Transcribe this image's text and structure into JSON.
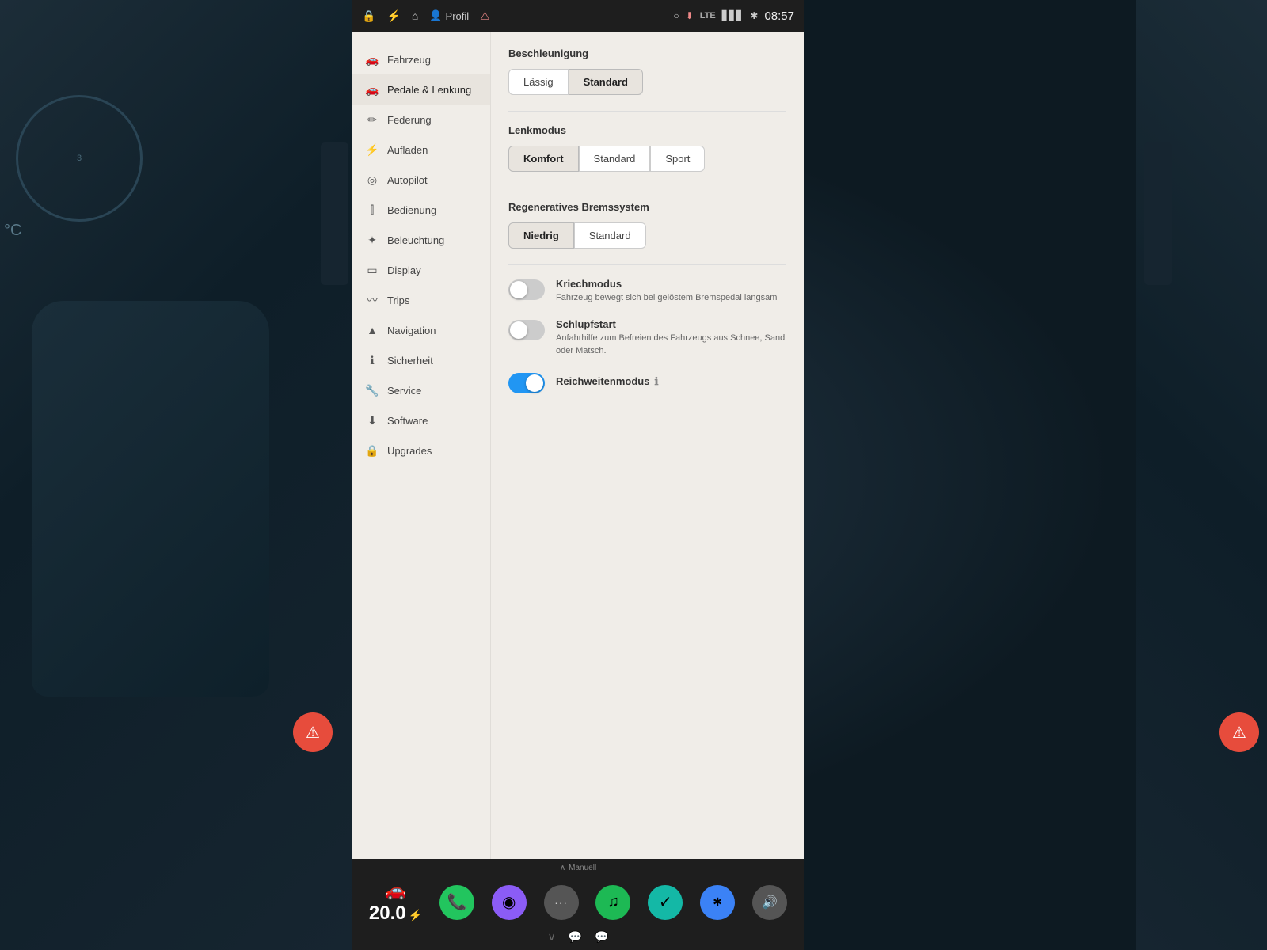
{
  "statusBar": {
    "icons": [
      "lock",
      "bolt",
      "home",
      "person",
      "warning"
    ],
    "profileLabel": "Profil",
    "time": "08:57",
    "lte": "LTE",
    "signalBars": "▋▋▋"
  },
  "sidebar": {
    "items": [
      {
        "id": "fahrzeug",
        "label": "Fahrzeug",
        "icon": "🚗",
        "active": false
      },
      {
        "id": "pedale-lenkung",
        "label": "Pedale & Lenkung",
        "icon": "🚗",
        "active": true
      },
      {
        "id": "federung",
        "label": "Federung",
        "icon": "✏",
        "active": false
      },
      {
        "id": "aufladen",
        "label": "Aufladen",
        "icon": "⚡",
        "active": false
      },
      {
        "id": "autopilot",
        "label": "Autopilot",
        "icon": "◎",
        "active": false
      },
      {
        "id": "bedienung",
        "label": "Bedienung",
        "icon": "≡",
        "active": false
      },
      {
        "id": "beleuchtung",
        "label": "Beleuchtung",
        "icon": "✦",
        "active": false
      },
      {
        "id": "display",
        "label": "Display",
        "icon": "▭",
        "active": false
      },
      {
        "id": "trips",
        "label": "Trips",
        "icon": "〰",
        "active": false
      },
      {
        "id": "navigation",
        "label": "Navigation",
        "icon": "▲",
        "active": false
      },
      {
        "id": "sicherheit",
        "label": "Sicherheit",
        "icon": "ℹ",
        "active": false
      },
      {
        "id": "service",
        "label": "Service",
        "icon": "🔧",
        "active": false
      },
      {
        "id": "software",
        "label": "Software",
        "icon": "⬇",
        "active": false
      },
      {
        "id": "upgrades",
        "label": "Upgrades",
        "icon": "🔒",
        "active": false
      }
    ]
  },
  "main": {
    "sections": {
      "beschleunigung": {
        "title": "Beschleunigung",
        "options": [
          {
            "id": "lassig",
            "label": "Lässig",
            "selected": false
          },
          {
            "id": "standard",
            "label": "Standard",
            "selected": true
          }
        ]
      },
      "lenkmodus": {
        "title": "Lenkmodus",
        "options": [
          {
            "id": "komfort",
            "label": "Komfort",
            "selected": true
          },
          {
            "id": "standard",
            "label": "Standard",
            "selected": false
          },
          {
            "id": "sport",
            "label": "Sport",
            "selected": false
          }
        ]
      },
      "bremssystem": {
        "title": "Regeneratives Bremssystem",
        "options": [
          {
            "id": "niedrig",
            "label": "Niedrig",
            "selected": true
          },
          {
            "id": "standard",
            "label": "Standard",
            "selected": false
          }
        ]
      },
      "kriechmodus": {
        "label": "Kriechmodus",
        "desc": "Fahrzeug bewegt sich bei gelöstem Bremspedal langsam",
        "enabled": false
      },
      "schlupfstart": {
        "label": "Schlupfstart",
        "desc": "Anfahrhilfe zum Befreien des Fahrzeugs aus Schnee, Sand oder Matsch.",
        "enabled": false
      },
      "reichweitenmodus": {
        "label": "Reichweitenmodus",
        "infoIcon": "ℹ",
        "enabled": true
      }
    }
  },
  "bottomBar": {
    "manuelLabel": "Manuell",
    "speedValue": "20.0",
    "speedUnit": "",
    "chevronUp": "∧",
    "chevronDown": "∨",
    "icons": [
      {
        "id": "phone",
        "color": "green",
        "symbol": "📞"
      },
      {
        "id": "media",
        "color": "purple",
        "symbol": "◉"
      },
      {
        "id": "more",
        "color": "gray",
        "symbol": "···"
      },
      {
        "id": "spotify",
        "color": "spotify",
        "symbol": "♫"
      },
      {
        "id": "maps",
        "color": "teal",
        "symbol": "✓"
      },
      {
        "id": "bluetooth",
        "color": "blue-bt",
        "symbol": "✱"
      },
      {
        "id": "volume",
        "color": "vol",
        "symbol": "🔊"
      }
    ],
    "bottomIcons": [
      "💬",
      "💬"
    ]
  },
  "temperature": "°C",
  "tempValue": "-"
}
